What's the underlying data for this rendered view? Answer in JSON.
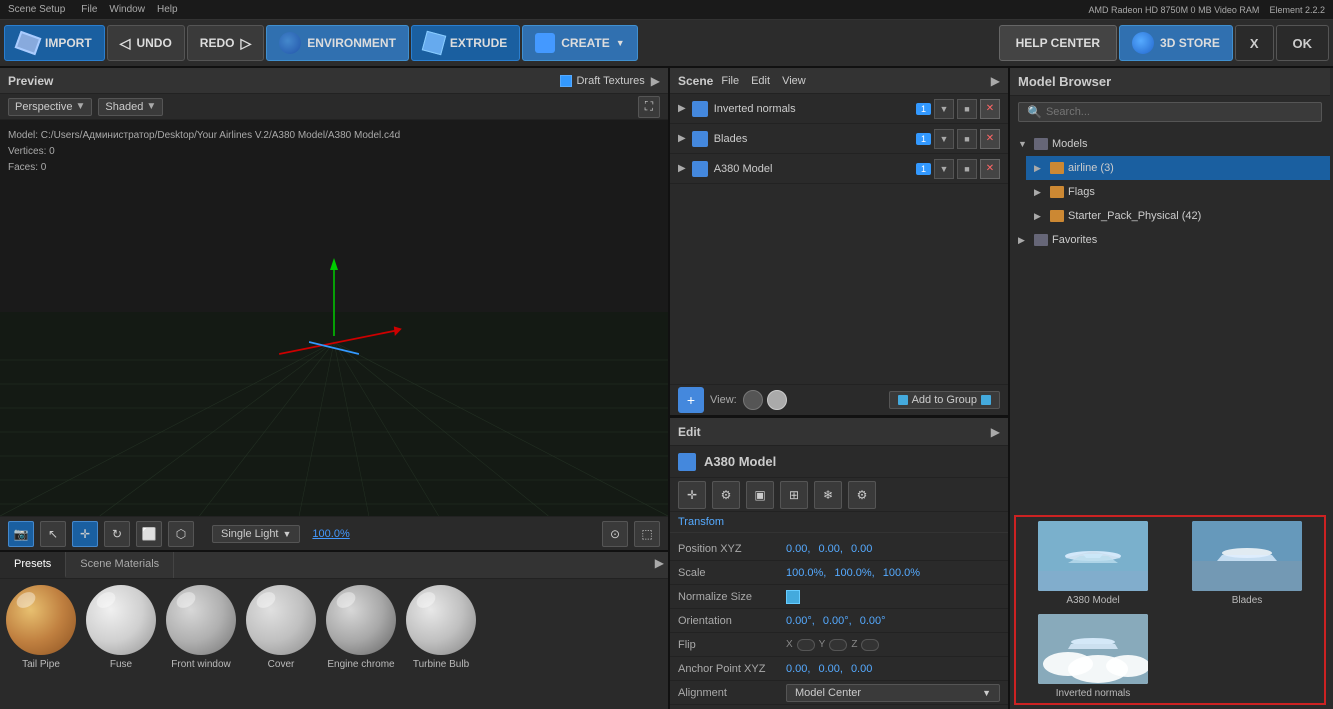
{
  "topbar": {
    "title": "Scene Setup",
    "menu": [
      "File",
      "Window",
      "Help"
    ],
    "right_info": "AMD Radeon HD 8750M\n0 MB Video RAM",
    "version": "Element 2.2.2"
  },
  "toolbar": {
    "import_label": "IMPORT",
    "undo_label": "UNDO",
    "redo_label": "REDO",
    "environment_label": "ENVIRONMENT",
    "extrude_label": "EXTRUDE",
    "create_label": "CREATE",
    "help_label": "HELP CENTER",
    "store_label": "3D STORE",
    "x_label": "X",
    "ok_label": "OK"
  },
  "preview": {
    "title": "Preview",
    "draft_textures": "Draft Textures",
    "perspective": "Perspective",
    "shaded": "Shaded",
    "model_path": "Model: C:/Users/Администратор/Desktop/Your Airlines V.2/A380 Model/A380 Model.c4d",
    "vertices": "Vertices: 0",
    "faces": "Faces: 0"
  },
  "viewport_bottom": {
    "single_light": "Single Light",
    "zoom": "100.0%"
  },
  "materials": {
    "tabs": [
      "Presets",
      "Scene Materials"
    ],
    "items": [
      {
        "label": "Tail Pipe",
        "type": "tail_pipe"
      },
      {
        "label": "Fuse",
        "type": "fuse"
      },
      {
        "label": "Front window",
        "type": "front_window"
      },
      {
        "label": "Cover",
        "type": "cover"
      },
      {
        "label": "Engine chrome",
        "type": "engine_chrome"
      },
      {
        "label": "Turbine Bulb",
        "type": "turbine"
      }
    ]
  },
  "scene": {
    "title": "Scene",
    "menu": [
      "File",
      "Edit",
      "View"
    ],
    "items": [
      {
        "name": "Inverted normals",
        "badge": "1",
        "color": "#4488dd"
      },
      {
        "name": "Blades",
        "badge": "1",
        "color": "#4488dd"
      },
      {
        "name": "A380 Model",
        "badge": "1",
        "color": "#4488dd"
      }
    ]
  },
  "scene_bottom": {
    "view_label": "View:",
    "add_to_group": "Add to Group"
  },
  "edit": {
    "section_title": "Edit",
    "model_name": "A380 Model",
    "transform_label": "Transfom",
    "position_xyz_label": "Position XYZ",
    "position_values": "0.00°,  0.00°,  0.00°",
    "scale_label": "Scale",
    "scale_values": "100.0%,  100.0%,  100.0%",
    "normalize_label": "Normalize Size",
    "orientation_label": "Orientation",
    "orientation_values": "0.00°,  0.00°,  0.00°",
    "flip_label": "Flip",
    "flip_xyz": "X  Y  Z",
    "anchor_label": "Anchor Point XYZ",
    "anchor_values": "0.00°,  0.00°,  0.00°",
    "alignment_label": "Alignment",
    "alignment_value": "Model Center"
  },
  "model_browser": {
    "title": "Model Browser",
    "search_placeholder": "Search...",
    "tree": [
      {
        "label": "Models",
        "level": 0,
        "expanded": true,
        "type": "folder"
      },
      {
        "label": "airline (3)",
        "level": 1,
        "selected": true,
        "type": "folder"
      },
      {
        "label": "Flags",
        "level": 1,
        "expanded": false,
        "type": "folder"
      },
      {
        "label": "Starter_Pack_Physical (42)",
        "level": 1,
        "type": "folder"
      },
      {
        "label": "Favorites",
        "level": 0,
        "type": "folder"
      }
    ],
    "thumbnails": [
      {
        "label": "A380 Model",
        "type": "sky"
      },
      {
        "label": "Blades",
        "type": "sky2"
      },
      {
        "label": "Inverted normals",
        "type": "clouds"
      }
    ]
  }
}
